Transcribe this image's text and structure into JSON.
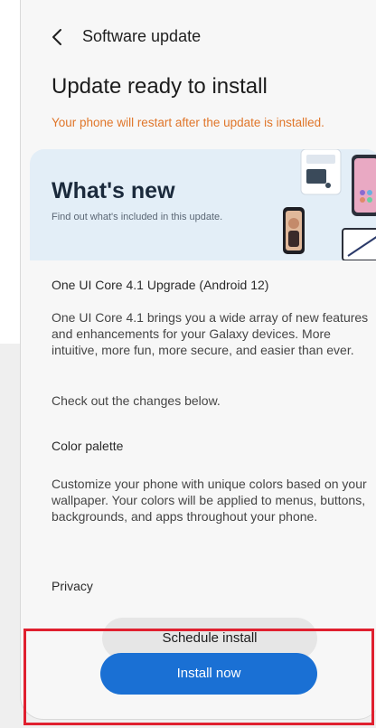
{
  "appbar": {
    "title": "Software update",
    "back_icon": "chevron-left-icon"
  },
  "headline": "Update ready to install",
  "restart_note": "Your phone will restart after the update is installed.",
  "banner": {
    "title": "What's new",
    "subtitle": "Find out what's included in this update."
  },
  "release": {
    "title": "One UI Core 4.1 Upgrade (Android 12)",
    "intro": "One UI Core 4.1 brings you a wide array of new features and enhancements for your Galaxy devices. More intuitive, more fun, more secure, and easier than ever.",
    "cta": "Check out the changes below.",
    "sections": [
      {
        "title": "Color palette",
        "body": "Customize your phone with unique colors based on your wallpaper. Your colors will be applied to menus, buttons, backgrounds, and apps throughout your phone."
      },
      {
        "title": "Privacy",
        "body": ""
      }
    ]
  },
  "buttons": {
    "schedule": "Schedule install",
    "install": "Install now"
  },
  "colors": {
    "accent": "#1a70d4",
    "warning": "#e0762a",
    "highlight": "#e0202f"
  }
}
